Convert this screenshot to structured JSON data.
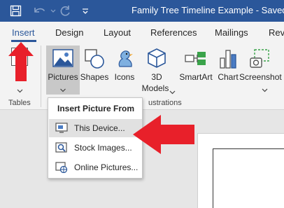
{
  "titlebar": {
    "title": "Family Tree Timeline Example  -  Saved to",
    "color": "#2b579a"
  },
  "tabs": [
    {
      "label": "Insert",
      "active": true
    },
    {
      "label": "Design"
    },
    {
      "label": "Layout"
    },
    {
      "label": "References"
    },
    {
      "label": "Mailings"
    },
    {
      "label": "Rev"
    }
  ],
  "ribbon": {
    "buttons": {
      "pictures": "Pictures",
      "shapes": "Shapes",
      "icons": "Icons",
      "models_line1": "3D",
      "models_line2": "Models",
      "smartart": "SmartArt",
      "chart": "Chart",
      "screenshot": "Screenshot"
    },
    "groups": {
      "tables": "Tables",
      "illustrations_partial": "ustrations"
    }
  },
  "menu": {
    "title": "Insert Picture From",
    "items": [
      {
        "label": "This Device...",
        "icon": "device-icon",
        "highlighted": true
      },
      {
        "label": "Stock Images...",
        "icon": "stock-images-icon"
      },
      {
        "label": "Online Pictures...",
        "icon": "online-pictures-icon"
      }
    ]
  },
  "colors": {
    "accent": "#2b579a",
    "annotation_arrow": "#e8202a",
    "ribbon_bg": "#f3f3f3"
  }
}
